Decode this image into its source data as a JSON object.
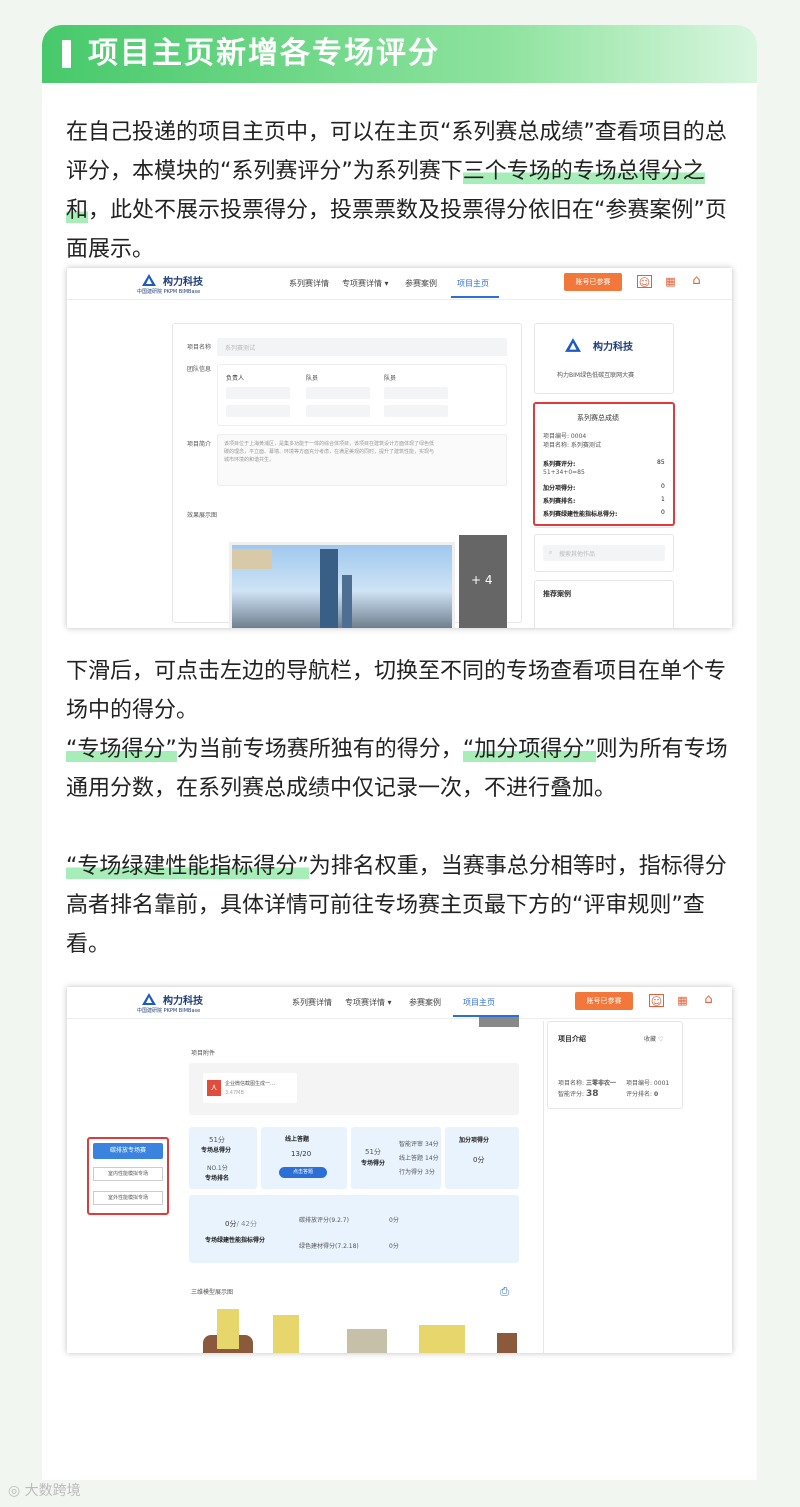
{
  "header": {
    "title": "项目主页新增各专场评分"
  },
  "para1": {
    "t1": "在自己投递的项目主页中，可以在主页“系列赛总成绩”查看项目的总评分，本模块的“系列赛评分”为系列赛下",
    "hl": "三个专场的专场总得分之和",
    "t2": "，此处不展示投票得分，投票票数及投票得分依旧在“参赛案例”页面展示。"
  },
  "para2": {
    "text": "下滑后，可点击左边的导航栏，切换至不同的专场查看项目在单个专场中的得分。"
  },
  "para3": {
    "hl1": "“专场得分”",
    "t1": "为当前专场赛所独有的得分，",
    "hl2": "“加分项得分”",
    "t2": "则为所有专场通用分数，在系列赛总成绩中仅记录一次，不进行叠加。"
  },
  "para4": {
    "hl": "“专场绿建性能指标得分”",
    "t": "为排名权重，当赛事总分相等时，指标得分高者排名靠前，具体详情可前往专场赛主页最下方的“评审规则”查看。"
  },
  "nav": {
    "logo": "构力科技",
    "logo_sub": "中国建研院 PKPM BIMBase",
    "items": [
      "系列赛详情",
      "专项赛详情",
      "参赛案例",
      "项目主页"
    ],
    "submit_btn": "账号已参赛"
  },
  "shot1": {
    "form_labels": [
      "项目名称",
      "团队信息",
      "项目简介",
      "效果展示图"
    ],
    "name_placeholder": "系列赛测试",
    "team_heads": [
      "负责人",
      "队员",
      "队员"
    ],
    "intro_text": "该项目位于上海黄浦区，是集多功能于一体的综合体项目，该项目在建筑设计方面体现了绿色低碳的理念，平立面、幕墙、环境等方面充分考虑，在满足美观的同时，提升了建筑性能，实现与城市环境的和谐共生。",
    "plus_more": "+ 4",
    "side_brand": "构力科技",
    "side_contest": "构力BIM绿色低碳互联网大赛",
    "score_title": "系列赛总成绩",
    "proj_no": "项目编号: 0004",
    "proj_name": "项目名称: 系列赛测试",
    "rows": [
      {
        "label": "系列赛评分:",
        "val": "85"
      },
      {
        "label": "加分项得分:",
        "val": "0"
      },
      {
        "label": "系列赛排名:",
        "val": "1"
      },
      {
        "label": "系列赛绿建性能指标总得分:",
        "val": "0"
      }
    ],
    "formula": "51+34+0=85",
    "search_placeholder": "搜索其他作品",
    "recommend": "推荐案例"
  },
  "shot2": {
    "attach_label": "项目附件",
    "file_name": "企业微信截图生成一…",
    "file_size": "3.47MB",
    "side_tabs": [
      "碳排放专场赛",
      "室内性能模拟专场",
      "室外性能模拟专场"
    ],
    "score_a": "51分",
    "score_a_label": "专场总得分",
    "rank": "NO.1分",
    "rank_label": "专场排名",
    "online_title": "线上答题",
    "online_val": "13/20",
    "answer_btn": "点击答题",
    "score_b": "51分",
    "score_b_label": "专场得分",
    "breakdown": [
      {
        "k": "智能评审",
        "v": "34分"
      },
      {
        "k": "线上答题",
        "v": "14分"
      },
      {
        "k": "行为得分",
        "v": "3分"
      }
    ],
    "bonus_title": "加分项得分",
    "bonus_val": "0分",
    "green_score": "0分",
    "green_total": "/ 42分",
    "green_label": "专场绿建性能指标得分",
    "green_items": [
      {
        "k": "碳排放评分(9.2.7)",
        "v": "0分"
      },
      {
        "k": "绿色建材得分(7.2.18)",
        "v": "0分"
      }
    ],
    "model_label": "三维模型展示图",
    "intro_title": "项目介绍",
    "fav": "收藏",
    "info_no_k": "项目名称:",
    "info_no_v": "三零非农一",
    "info_code": "项目编号: 0001",
    "info_score_k": "智能评分:",
    "info_score_v": "38",
    "info_rank": "评分排名:",
    "info_rank_v": "0"
  },
  "watermark": "大数跨境"
}
